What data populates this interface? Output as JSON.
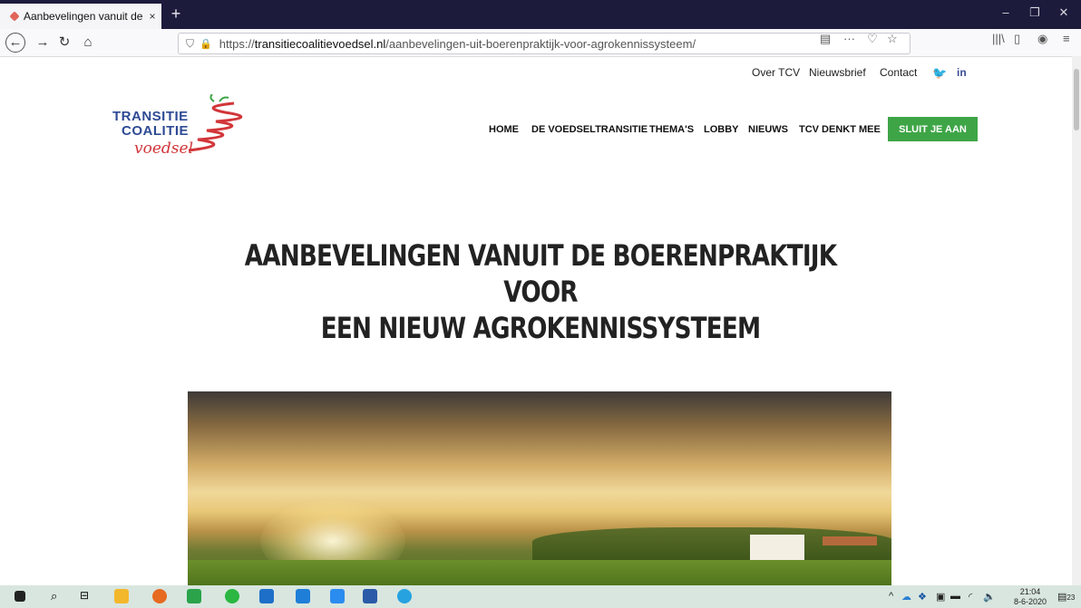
{
  "browser": {
    "tab_title": "Aanbevelingen vanuit de",
    "tab_close": "×",
    "new_tab": "+",
    "url_prefix": "https://",
    "url_host": "transitiecoalitievoedsel.nl",
    "url_path": "/aanbevelingen-uit-boerenpraktijk-voor-agrokennissysteem/",
    "url_more": "···"
  },
  "site": {
    "top_links": [
      "Over TCV",
      "Nieuwsbrief",
      "Contact"
    ],
    "social": [
      "twitter-icon",
      "linkedin-icon"
    ],
    "linkedin_text": "in",
    "logo": {
      "line1": "TRANSITIE",
      "line2": "COALITIE",
      "line3": "voedsel"
    },
    "nav": [
      "HOME",
      "DE VOEDSELTRANSITIE",
      "THEMA'S",
      "LOBBY",
      "NIEUWS",
      "TCV DENKT MEE"
    ],
    "cta": "SLUIT JE AAN",
    "headline_line1": "AANBEVELINGEN VANUIT DE BOERENPRAKTIJK VOOR",
    "headline_line2": "EEN NIEUW AGROKENNISSYSTEEM"
  },
  "taskbar": {
    "time": "21:04",
    "date": "8-6-2020",
    "notification_count": "23"
  },
  "colors": {
    "cta_green": "#3ea546",
    "logo_blue": "#2e4a94",
    "logo_red": "#d2363a",
    "tabbar": "#1c1b3c"
  }
}
